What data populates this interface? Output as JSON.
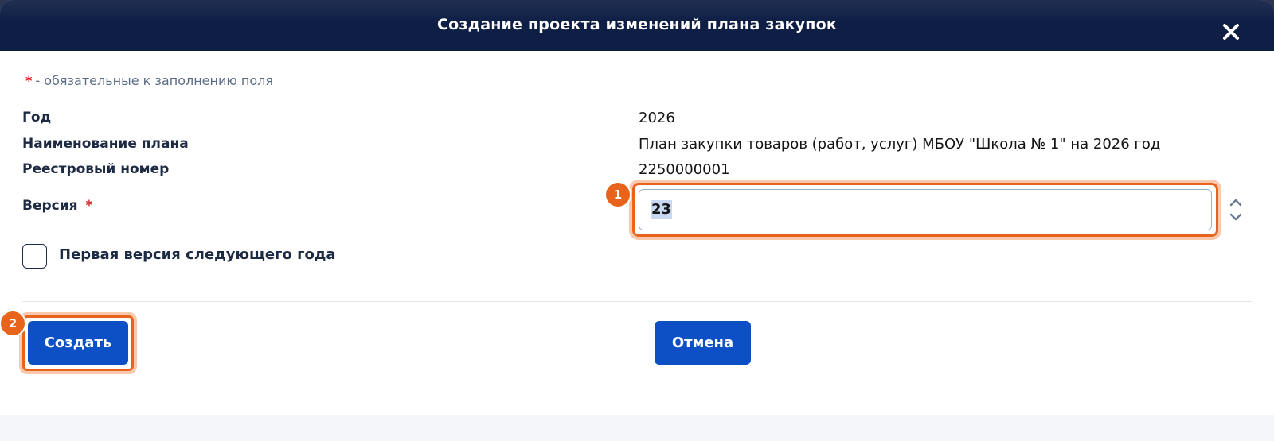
{
  "dialog": {
    "title": "Создание проекта изменений плана закупок",
    "close_icon": "close-icon"
  },
  "form": {
    "required_star": "*",
    "required_note": "- обязательные к заполнению поля",
    "fields": {
      "year_label": "Год",
      "year_value": "2026",
      "plan_name_label": "Наименование плана",
      "plan_name_value": "План закупки товаров (работ, услуг) МБОУ \"Школа № 1\" на 2026 год",
      "registry_label": "Реестровый номер",
      "registry_value": "2250000001",
      "version_label": "Версия",
      "version_required_star": "*",
      "version_value": "23"
    },
    "checkbox": {
      "label": "Первая версия следующего года",
      "checked": false
    }
  },
  "buttons": {
    "create_label": "Создать",
    "cancel_label": "Отмена"
  },
  "annotations": {
    "step1": "1",
    "step2": "2"
  },
  "colors": {
    "header": "#0e1e45",
    "primary_button": "#0d4fc4",
    "highlight": "#e8641c",
    "required": "#e0202a"
  }
}
